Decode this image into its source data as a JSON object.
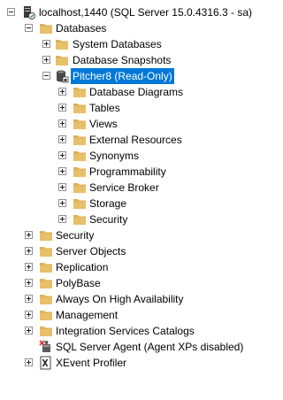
{
  "tree": {
    "server": {
      "label": "localhost,1440 (SQL Server 15.0.4316.3 - sa)"
    },
    "databases": {
      "label": "Databases",
      "system_databases": "System Databases",
      "database_snapshots": "Database Snapshots",
      "pitcher": {
        "label": "Pitcher8 (Read-Only)",
        "children": [
          "Database Diagrams",
          "Tables",
          "Views",
          "External Resources",
          "Synonyms",
          "Programmability",
          "Service Broker",
          "Storage",
          "Security"
        ]
      }
    },
    "server_nodes": [
      "Security",
      "Server Objects",
      "Replication",
      "PolyBase",
      "Always On High Availability",
      "Management",
      "Integration Services Catalogs"
    ],
    "sql_agent": "SQL Server Agent (Agent XPs disabled)",
    "xevent_profiler": "XEvent Profiler"
  },
  "colors": {
    "folder": "#dcb35c",
    "selection": "#0078d7",
    "toggle_border": "#919191"
  }
}
